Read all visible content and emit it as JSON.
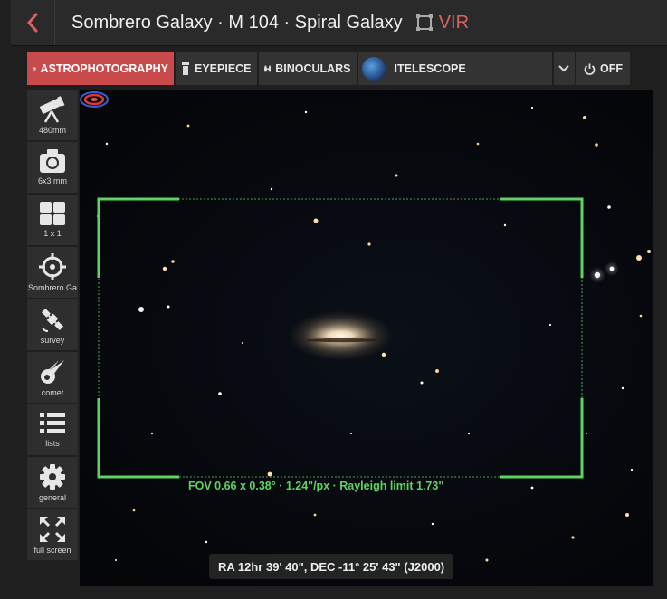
{
  "header": {
    "title": "Sombrero Galaxy · M 104 · Spiral Galaxy",
    "vir_label": "VIR"
  },
  "modes": {
    "astrophotography": "ASTROPHOTOGRAPHY",
    "eyepiece": "EYEPIECE",
    "binoculars": "BINOCULARS",
    "telescope": "ITELESCOPE",
    "off": "OFF"
  },
  "sidebar": {
    "telescope": "480mm",
    "camera": "6x3 mm",
    "mosaic": "1 x 1",
    "target": "Sombrero Ga",
    "survey": "survey",
    "comet": "comet",
    "lists": "lists",
    "general": "general",
    "fullscreen": "full screen"
  },
  "view": {
    "fov_text": "FOV 0.66 x 0.38° · 1.24\"/px · Rayleigh limit 1.73\"",
    "coordinates": "RA 12hr 39' 40\", DEC -11° 25' 43\" (J2000)"
  },
  "colors": {
    "accent_red": "#c94a4a",
    "fov_green": "#5fd35f"
  }
}
